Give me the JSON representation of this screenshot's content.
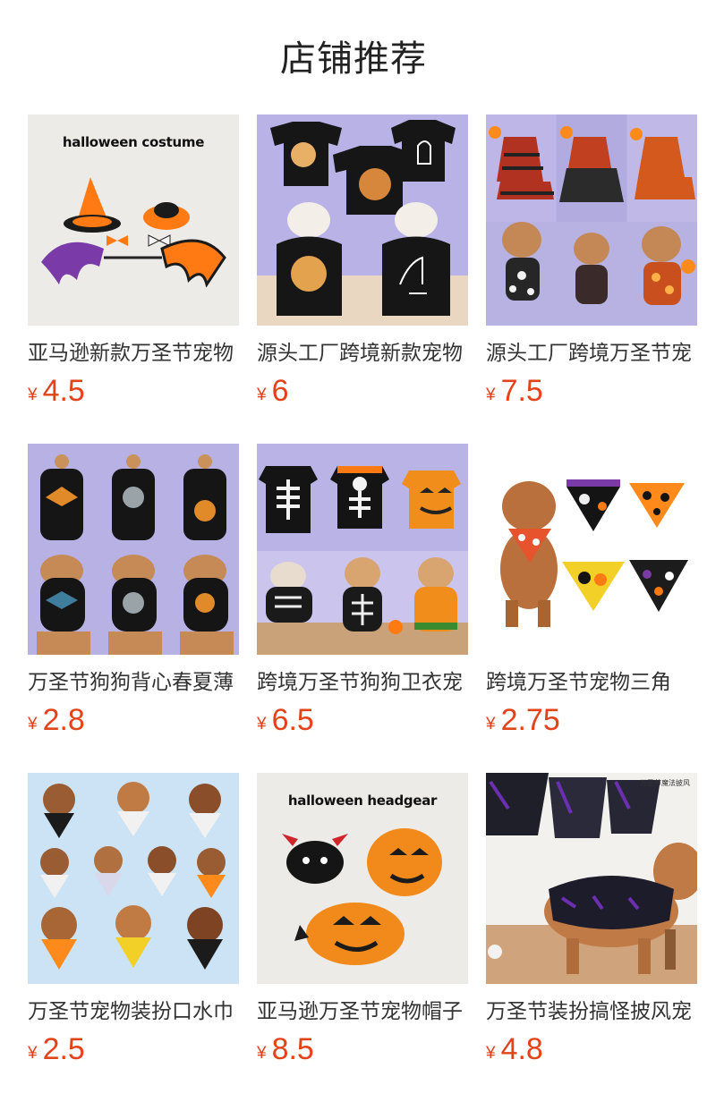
{
  "page_title": "店铺推荐",
  "colors": {
    "price": "#e2441a",
    "title": "#222222",
    "text": "#333333"
  },
  "products": [
    {
      "name": "亚马逊新款万圣节宠物",
      "currency": "¥",
      "price": "4.5",
      "image_caption": "halloween costume",
      "image": "pet-halloween-costume-photo"
    },
    {
      "name": "源头工厂跨境新款宠物",
      "currency": "¥",
      "price": "6",
      "image_caption": "",
      "image": "black-cat-sweater-photo"
    },
    {
      "name": "源头工厂跨境万圣节宠",
      "currency": "¥",
      "price": "7.5",
      "image_caption": "",
      "image": "pumpkin-dog-dress-photo"
    },
    {
      "name": "万圣节狗狗背心春夏薄",
      "currency": "¥",
      "price": "2.8",
      "image_caption": "",
      "image": "halloween-dog-vest-photo"
    },
    {
      "name": "跨境万圣节狗狗卫衣宠",
      "currency": "¥",
      "price": "6.5",
      "image_caption": "",
      "image": "skeleton-dog-hoodie-photo"
    },
    {
      "name": "跨境万圣节宠物三角",
      "currency": "¥",
      "price": "2.75",
      "image_caption": "",
      "image": "halloween-bandana-photo"
    },
    {
      "name": "万圣节宠物装扮口水巾",
      "currency": "¥",
      "price": "2.5",
      "image_caption": "",
      "image": "dog-drool-bib-photo"
    },
    {
      "name": "亚马逊万圣节宠物帽子",
      "currency": "¥",
      "price": "8.5",
      "image_caption": "halloween headgear",
      "image": "halloween-headgear-photo"
    },
    {
      "name": "万圣节装扮搞怪披风宠",
      "currency": "¥",
      "price": "4.8",
      "image_caption": "",
      "image_corner_text": "万圣节魔法披风",
      "image": "halloween-cape-photo"
    }
  ]
}
